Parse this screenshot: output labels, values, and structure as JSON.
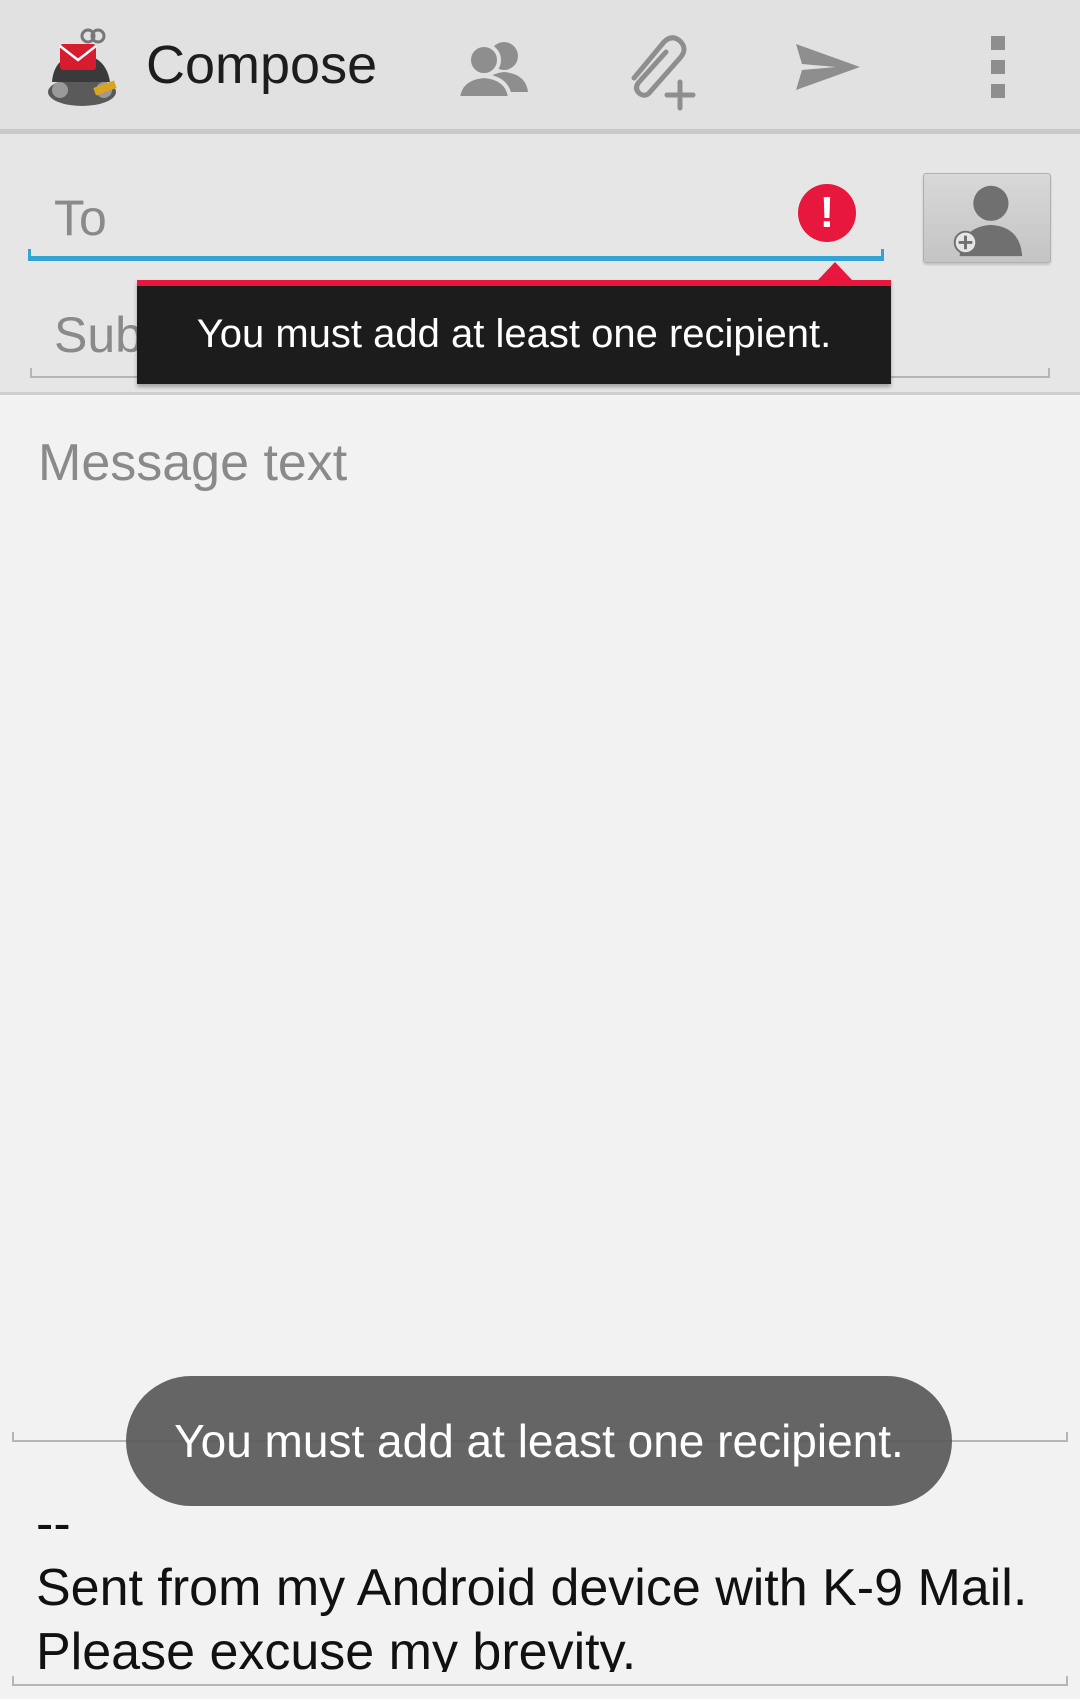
{
  "action_bar": {
    "title": "Compose",
    "icons": [
      "k9-mail-app-icon",
      "add-cc-bcc-icon",
      "attach-file-icon",
      "send-icon",
      "overflow-menu-icon"
    ]
  },
  "to_field": {
    "placeholder": "To",
    "value": "",
    "error_icon": "!"
  },
  "subject_field": {
    "placeholder": "Subject",
    "value": ""
  },
  "error_popup": {
    "text": "You must add at least one recipient."
  },
  "message_field": {
    "placeholder": "Message text",
    "value": ""
  },
  "signature": {
    "text": "--\nSent from my Android device with K-9 Mail. Please excuse my brevity."
  },
  "toast": {
    "text": "You must add at least one recipient."
  },
  "colors": {
    "accent_blue": "#33a3d6",
    "error_red": "#e8173e",
    "action_bar_bg": "#e1e1e1"
  }
}
